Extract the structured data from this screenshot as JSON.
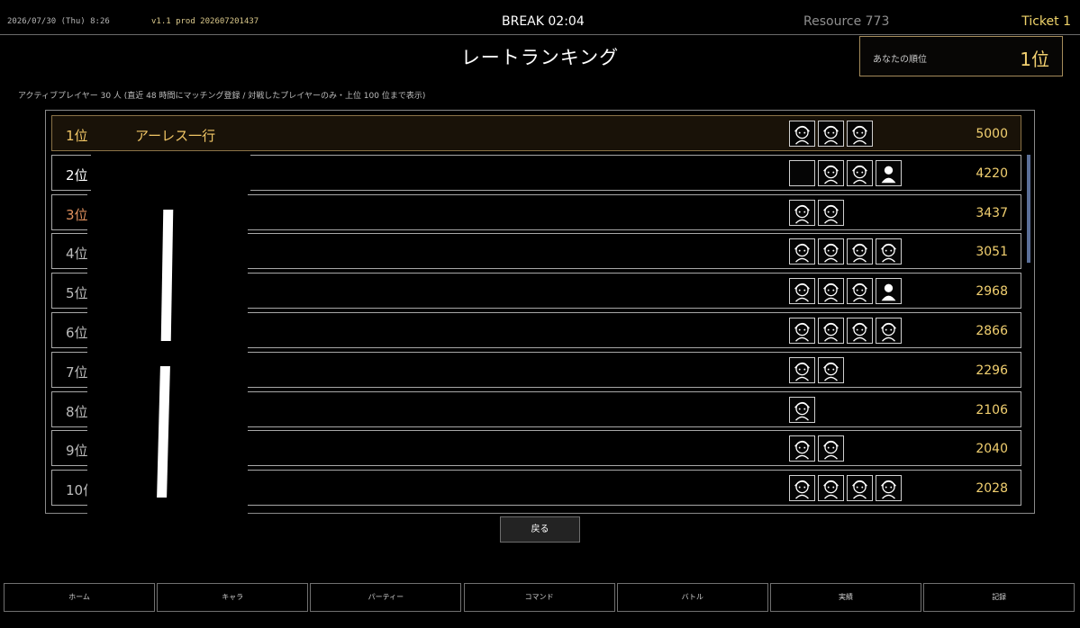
{
  "topbar": {
    "datetime": "2026/07/30 (Thu) 8:26",
    "version": "v1.1 prod 202607201437",
    "timer": "BREAK 02:04",
    "resource": "Resource 773",
    "ticket": "Ticket 1"
  },
  "title": "レートランキング",
  "my_rank": {
    "label": "あなたの順位",
    "value": "1位"
  },
  "note": "アクティブプレイヤー 30 人 (直近 48 時間にマッチング登録 / 対戦したプレイヤーのみ・上位 100 位まで表示)",
  "rankings": [
    {
      "rank": "1位",
      "name": "アーレス一行",
      "score": "5000",
      "rank_color": "#f2c766",
      "icons": [
        "knight-icon",
        "girl-icon",
        "mage-icon"
      ]
    },
    {
      "rank": "2位",
      "name": "",
      "score": "4220",
      "rank_color": "#ffffff",
      "icons": [
        "blank-icon",
        "girl-icon",
        "girl-icon",
        "silhouette-icon"
      ]
    },
    {
      "rank": "3位",
      "name": "",
      "score": "3437",
      "rank_color": "#e0915e",
      "icons": [
        "witch-icon",
        "girl-icon"
      ]
    },
    {
      "rank": "4位",
      "name": "",
      "score": "3051",
      "rank_color": "#bdbdbd",
      "icons": [
        "girl-icon",
        "catgirl-icon",
        "girl-icon",
        "girl-icon"
      ]
    },
    {
      "rank": "5位",
      "name": "",
      "score": "2968",
      "rank_color": "#bdbdbd",
      "icons": [
        "elf-icon",
        "girl-icon",
        "witch-icon",
        "silhouette-icon"
      ]
    },
    {
      "rank": "6位",
      "name": "",
      "score": "2866",
      "rank_color": "#bdbdbd",
      "icons": [
        "girl-icon",
        "girl-icon",
        "girl-icon",
        "girl-icon"
      ]
    },
    {
      "rank": "7位",
      "name": "",
      "score": "2296",
      "rank_color": "#bdbdbd",
      "icons": [
        "girl-icon",
        "girl-icon"
      ]
    },
    {
      "rank": "8位",
      "name": "",
      "score": "2106",
      "rank_color": "#bdbdbd",
      "icons": [
        "staff-icon"
      ]
    },
    {
      "rank": "9位",
      "name": "",
      "score": "2040",
      "rank_color": "#bdbdbd",
      "icons": [
        "cat-icon",
        "boy-icon"
      ]
    },
    {
      "rank": "10位",
      "name": "",
      "score": "2028",
      "rank_color": "#bdbdbd",
      "icons": [
        "mage-icon",
        "girl-icon",
        "map-icon",
        "sparkle-icon"
      ]
    }
  ],
  "back_button": "戻る",
  "nav": [
    "ホーム",
    "キャラ",
    "パーティー",
    "コマンド",
    "バトル",
    "実績",
    "記録"
  ],
  "colors": {
    "gold": "#f2d070",
    "bronze": "#e0915e",
    "scrollbar": "#5b6f98"
  }
}
